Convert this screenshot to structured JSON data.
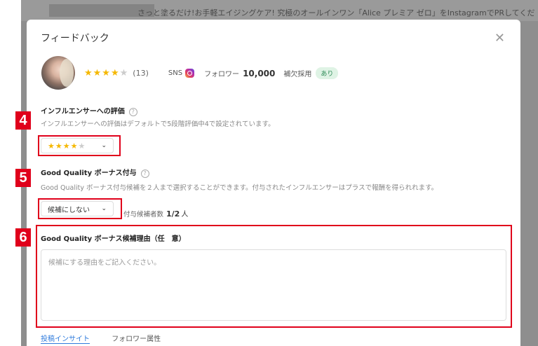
{
  "background": {
    "banner_text": "さっと塗るだけ!お手軽エイジングケア! 究極のオールインワン「Alice プレミア ゼロ」をInstagramでPRしてください!"
  },
  "modal": {
    "title": "フィードバック",
    "close_icon": "close-icon"
  },
  "profile": {
    "stars_filled": "★★★★",
    "stars_empty": "★",
    "rating": 4,
    "review_count": "(13)",
    "sns_label": "SNS",
    "sns_icon": "instagram-icon",
    "followers_label": "フォロワー",
    "followers_value": "10,000",
    "hoketsu_label": "補欠採用",
    "hoketsu_badge": "あり"
  },
  "influencer_rating": {
    "title": "インフルエンサーへの評価",
    "help_icon": "?",
    "description": "インフルエンサーへの評価はデフォルトで5段階評価中4で設定されています。",
    "select_stars_filled": "★★★★",
    "select_stars_empty": "★",
    "select_value": 4
  },
  "bonus": {
    "title": "Good Quality ボーナス付与",
    "help_icon": "?",
    "description": "Good Quality ボーナス付与候補を２人まで選択することができます。付与されたインフルエンサーはプラスで報酬を得られれます。",
    "select_value": "候補にしない",
    "count_label": "付与候補者数",
    "count_value": "1/2",
    "count_unit": "人"
  },
  "reason": {
    "title": "Good Quality ボーナス候補理由（任　意）",
    "placeholder": "候補にする理由をご記入ください。"
  },
  "tabs": [
    {
      "label": "投稿インサイト",
      "active": true
    },
    {
      "label": "フォロワー属性",
      "active": false
    }
  ],
  "annotations": [
    "4",
    "5",
    "6"
  ],
  "colors": {
    "annotation_red": "#e0001b",
    "star_gold": "#f5b800",
    "link_blue": "#2f7bdc",
    "badge_green": "#2e8b57"
  }
}
